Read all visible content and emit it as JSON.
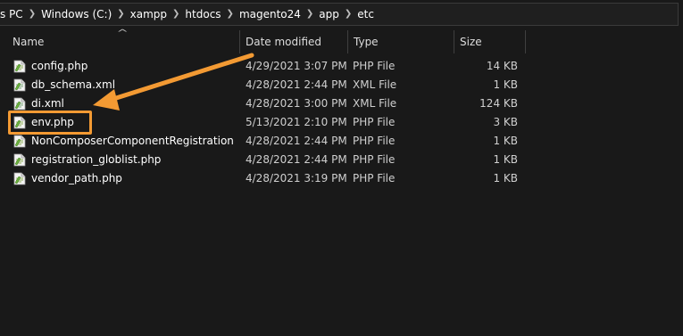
{
  "address_bar": {
    "crumbs": [
      "s PC",
      "Windows (C:)",
      "xampp",
      "htdocs",
      "magento24",
      "app",
      "etc"
    ],
    "separator_icon": "chevron-right-icon"
  },
  "columns": {
    "name": "Name",
    "date_modified": "Date modified",
    "type": "Type",
    "size": "Size",
    "sort_icon": "sort-ascending-icon"
  },
  "files": [
    {
      "name": "config.php",
      "date_modified": "4/29/2021 3:07 PM",
      "type": "PHP File",
      "size": "14 KB",
      "icon": "php-file-icon"
    },
    {
      "name": "db_schema.xml",
      "date_modified": "4/28/2021 2:44 PM",
      "type": "XML File",
      "size": "1 KB",
      "icon": "xml-file-icon"
    },
    {
      "name": "di.xml",
      "date_modified": "4/28/2021 3:00 PM",
      "type": "XML File",
      "size": "124 KB",
      "icon": "xml-file-icon"
    },
    {
      "name": "env.php",
      "date_modified": "5/13/2021 2:10 PM",
      "type": "PHP File",
      "size": "3 KB",
      "icon": "php-file-icon"
    },
    {
      "name": "NonComposerComponentRegistration.p...",
      "date_modified": "4/28/2021 2:44 PM",
      "type": "PHP File",
      "size": "1 KB",
      "icon": "php-file-icon"
    },
    {
      "name": "registration_globlist.php",
      "date_modified": "4/28/2021 2:44 PM",
      "type": "PHP File",
      "size": "1 KB",
      "icon": "php-file-icon"
    },
    {
      "name": "vendor_path.php",
      "date_modified": "4/28/2021 3:19 PM",
      "type": "PHP File",
      "size": "1 KB",
      "icon": "php-file-icon"
    }
  ],
  "annotation": {
    "highlighted_file": "env.php",
    "color": "#f39a33"
  },
  "colors": {
    "background": "#191919",
    "text": "#ffffff",
    "annotation": "#f39a33"
  }
}
